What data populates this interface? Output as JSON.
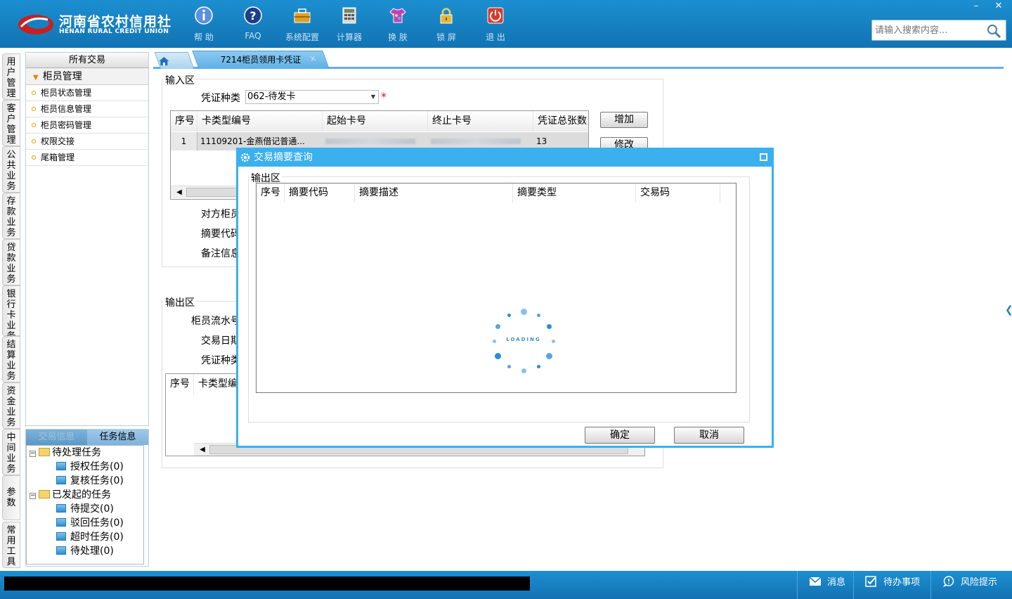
{
  "app": {
    "logo_cn": "河南省农村信用社",
    "logo_en": "HENAN RURAL CREDIT UNION",
    "colors": {
      "header_blue": "#1680c2",
      "accent": "#3ab0ef",
      "required": "#e01010"
    }
  },
  "toolbar": {
    "items": [
      {
        "label": "帮 助",
        "icon": "info-icon"
      },
      {
        "label": "FAQ",
        "icon": "question-icon"
      },
      {
        "label": "系统配置",
        "icon": "toolbox-icon"
      },
      {
        "label": "计算器",
        "icon": "calculator-icon"
      },
      {
        "label": "换 肤",
        "icon": "shirt-icon"
      },
      {
        "label": "锁 屏",
        "icon": "lock-icon"
      },
      {
        "label": "退 出",
        "icon": "power-icon"
      }
    ]
  },
  "search": {
    "placeholder": "请输入搜索内容..."
  },
  "window_controls": {
    "minimize": "–",
    "close": "✕"
  },
  "vertical_tabs": [
    "用户管理",
    "客户管理",
    "公共业务",
    "存款业务",
    "贷款业务",
    "银行卡业务",
    "结算业务",
    "资金业务",
    "中间业务",
    "参数",
    "常用工具"
  ],
  "nav": {
    "header": "所有交易",
    "group": "柜员管理",
    "items": [
      "柜员状态管理",
      "柜员信息管理",
      "柜员密码管理",
      "权限交接",
      "尾箱管理"
    ]
  },
  "task_panel": {
    "tabs": [
      "交易信息",
      "任务信息"
    ],
    "pending": {
      "label": "待处理任务",
      "children": [
        "授权任务(0)",
        "复核任务(0)"
      ]
    },
    "initiated": {
      "label": "已发起的任务",
      "children": [
        "待提交(0)",
        "驳回任务(0)",
        "超时任务(0)",
        "待处理(0)"
      ]
    }
  },
  "tabs": {
    "active": "7214柜员领用卡凭证",
    "close": "×"
  },
  "input_area": {
    "title": "输入区",
    "voucher_type_label": "凭证种类",
    "voucher_type_value": "062-待发卡",
    "required_mark": "*",
    "table": {
      "headers": [
        "序号",
        "卡类型编号",
        "起始卡号",
        "终止卡号",
        "凭证总张数"
      ],
      "rows": [
        [
          "1",
          "11109201-金燕借记普通...",
          "",
          "",
          "13"
        ]
      ]
    },
    "labels": [
      "对方柜员",
      "摘要代码",
      "备注信息"
    ],
    "buttons": [
      "增加",
      "修改"
    ]
  },
  "output_area": {
    "title": "输出区",
    "labels": [
      "柜员流水号",
      "交易日期",
      "凭证种类"
    ],
    "table_headers": [
      "序号",
      "卡类型编"
    ]
  },
  "modal": {
    "title": "交易摘要查询",
    "section": "输出区",
    "headers": [
      "序号",
      "摘要代码",
      "摘要描述",
      "摘要类型",
      "交易码"
    ],
    "loading_text": "LOADING",
    "ok": "确定",
    "cancel": "取消"
  },
  "status_bar": {
    "items": [
      {
        "label": "消息",
        "icon": "mail-icon"
      },
      {
        "label": "待办事项",
        "icon": "checkbox-icon"
      },
      {
        "label": "风险提示",
        "icon": "chat-icon"
      }
    ]
  }
}
